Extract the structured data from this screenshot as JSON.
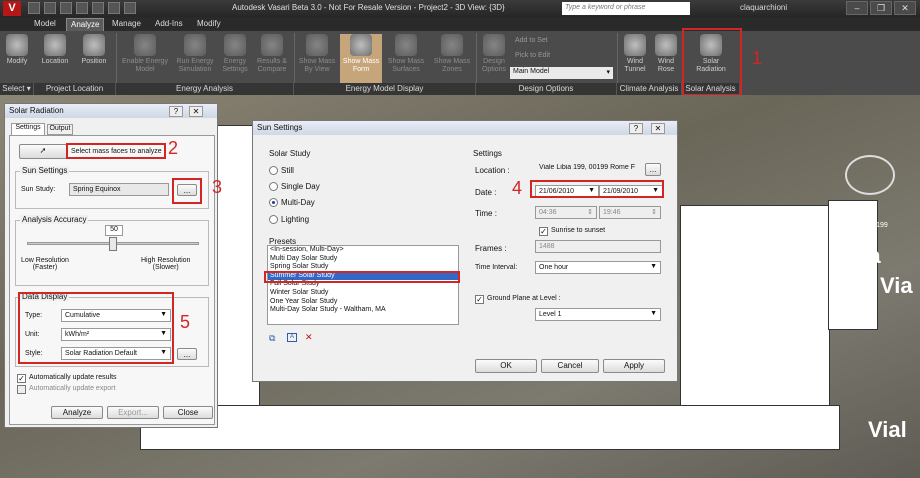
{
  "app": {
    "title": "Autodesk Vasari Beta 3.0 - Not For Resale Version -    Project2 - 3D View: {3D}",
    "search_placeholder": "Type a keyword or phrase",
    "user": "claquarchioni",
    "logo": "V"
  },
  "menu_tabs": [
    "Model",
    "Analyze",
    "Manage",
    "Add-Ins",
    "Modify"
  ],
  "ribbon": {
    "buttons": [
      {
        "label": "Modify",
        "icon": "cursor-icon"
      },
      {
        "label": "Location",
        "icon": "globe-icon"
      },
      {
        "label": "Position",
        "icon": "position-icon"
      },
      {
        "label": "Enable Energy Model",
        "icon": "energy-icon"
      },
      {
        "label": "Run Energy Simulation",
        "icon": "run-icon"
      },
      {
        "label": "Energy Settings",
        "icon": "settings-icon"
      },
      {
        "label": "Results & Compare",
        "icon": "compare-icon"
      },
      {
        "label": "Show Mass By View",
        "icon": "mass-icon"
      },
      {
        "label": "Show Mass Form",
        "icon": "mass-form-icon"
      },
      {
        "label": "Show Mass Surfaces",
        "icon": "mass-surfaces-icon"
      },
      {
        "label": "Show Mass Zones",
        "icon": "mass-zones-icon"
      },
      {
        "label": "Design Options",
        "icon": "design-options-icon"
      },
      {
        "label": "Wind Tunnel",
        "icon": "wind-tunnel-icon"
      },
      {
        "label": "Wind Rose",
        "icon": "wind-rose-icon"
      },
      {
        "label": "Solar Radiation",
        "icon": "solar-radiation-icon"
      }
    ],
    "small": {
      "add_to_set": "Add to Set",
      "pick_to_edit": "Pick to Edit",
      "main_model": "Main Model"
    },
    "groups": [
      "Select ▾",
      "Project Location",
      "Energy Analysis",
      "Energy Model Display",
      "Design Options",
      "Climate Analysis",
      "Solar Analysis"
    ]
  },
  "viewport": {
    "road1": "Via",
    "road2": "Via",
    "road3": "Vial",
    "street_label": "Viale Libia 199"
  },
  "solar_dialog": {
    "title": "Solar Radiation",
    "tabs": [
      "Settings",
      "Output"
    ],
    "select_faces_label": "Select mass faces to analyze",
    "sun_settings_label": "Sun Settings",
    "sun_study_label": "Sun Study:",
    "sun_study_value": "Spring Equinox",
    "browse_label": "...",
    "accuracy_label": "Analysis Accuracy",
    "accuracy_value": "50",
    "accuracy_fraction": 0.5,
    "low_res": "Low Resolution\n(Faster)",
    "high_res": "High Resolution\n(Slower)",
    "data_display_label": "Data Display",
    "type_label": "Type:",
    "type_value": "Cumulative",
    "unit_label": "Unit:",
    "unit_value": "kWh/m²",
    "style_label": "Style:",
    "style_value": "Solar Radiation Default",
    "style_browse": "...",
    "auto_update_results": "Automatically update results",
    "auto_update_results_checked": true,
    "auto_update_export": "Automatically update export",
    "auto_update_export_checked": false,
    "analyze": "Analyze",
    "export": "Export...",
    "close": "Close"
  },
  "sun_dialog": {
    "title": "Sun Settings",
    "solar_study_label": "Solar Study",
    "options": [
      "Still",
      "Single Day",
      "Multi-Day",
      "Lighting"
    ],
    "selected_option": "Multi-Day",
    "presets_label": "Presets",
    "presets": [
      "<In-session, Multi-Day>",
      "Multi Day Solar Study",
      "Spring Solar Study",
      "Summer Solar Study",
      "Fall Solar Study",
      "Winter Solar Study",
      "One Year Solar Study",
      "Multi-Day Solar Study - Waltham, MA"
    ],
    "selected_preset": "Summer Solar Study",
    "settings_label": "Settings",
    "location_label": "Location :",
    "location_value": "Viale Libia 199, 00199 Rome F",
    "location_browse": "...",
    "date_label": "Date :",
    "date_from": "21/06/2010",
    "date_to": "21/09/2010",
    "time_label": "Time :",
    "time_from": "04:36",
    "time_to": "19:46",
    "sunrise_label": "Sunrise to sunset",
    "frames_label": "Frames :",
    "frames_value": "1488",
    "interval_label": "Time Interval:",
    "interval_value": "One hour",
    "ground_plane_label": "Ground Plane at Level :",
    "level_value": "Level 1",
    "ok": "OK",
    "cancel": "Cancel",
    "apply": "Apply"
  },
  "annotations": [
    "1",
    "2",
    "3",
    "4",
    "5"
  ],
  "colors": {
    "annotation": "#d42525",
    "ribbon": "#4b4b4b",
    "selection": "#3169c6"
  }
}
